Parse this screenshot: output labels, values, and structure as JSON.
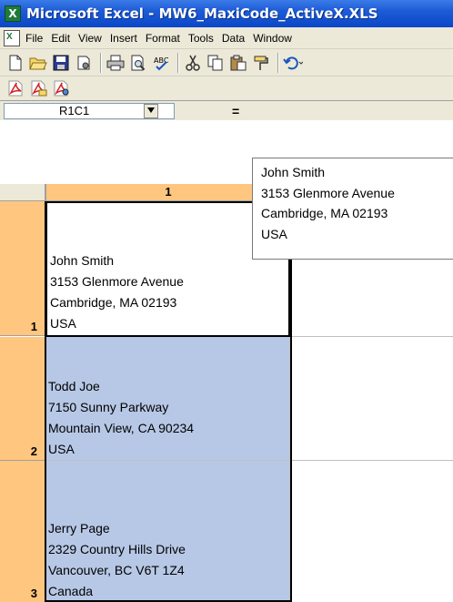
{
  "window": {
    "title": "Microsoft Excel - MW6_MaxiCode_ActiveX.XLS"
  },
  "menu": {
    "items": [
      "File",
      "Edit",
      "View",
      "Insert",
      "Format",
      "Tools",
      "Data",
      "Window"
    ]
  },
  "toolbar": {
    "icons": [
      "new-icon",
      "open-icon",
      "save-icon",
      "permission-icon",
      "print-icon",
      "print-preview-icon",
      "spelling-icon",
      "cut-icon",
      "copy-icon",
      "paste-icon",
      "format-painter-icon",
      "undo-icon"
    ]
  },
  "pdf_toolbar": {
    "icons": [
      "pdf-convert-icon",
      "pdf-convert-email-icon",
      "pdf-review-icon"
    ]
  },
  "formula_bar": {
    "name_box": "R1C1",
    "equals": "=",
    "content": [
      "John Smith",
      "3153 Glenmore Avenue",
      "Cambridge, MA 02193",
      "USA"
    ]
  },
  "sheet": {
    "column_header": "1",
    "rows": [
      {
        "num": "1",
        "lines": [
          "John Smith",
          "3153 Glenmore Avenue",
          "Cambridge, MA 02193",
          "USA"
        ]
      },
      {
        "num": "2",
        "lines": [
          "Todd Joe",
          "7150 Sunny Parkway",
          "Mountain View, CA 90234",
          "USA"
        ]
      },
      {
        "num": "3",
        "lines": [
          "Jerry Page",
          "2329 Country Hills Drive",
          "Vancouver, BC V6T 1Z4",
          "Canada"
        ]
      }
    ]
  },
  "colors": {
    "title_bar": "#1d5bd6",
    "selection": "#b7c8e6",
    "header_highlight": "#ffc680",
    "chrome": "#ece9d8"
  }
}
